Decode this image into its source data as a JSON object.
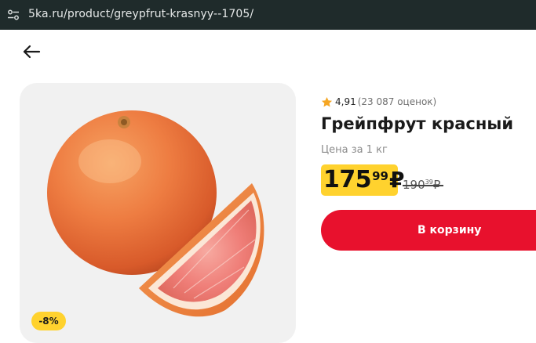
{
  "browser": {
    "url": "5ka.ru/product/greypfrut-krasnyy--1705/"
  },
  "navigation": {
    "back_icon": "arrow-left-icon"
  },
  "product": {
    "rating": "4,91",
    "rating_count": "(23 087 оценок)",
    "title": "Грейпфрут красный",
    "unit_price_label": "Цена за 1 кг",
    "price": {
      "rubles": "175",
      "kopecks": "99",
      "currency": "₽"
    },
    "old_price": {
      "rubles": "190",
      "kopecks": "39",
      "currency": "₽"
    },
    "discount_badge": "-8%",
    "add_to_cart_label": "В корзину",
    "image_subject": "grapefruit"
  },
  "colors": {
    "accent_red": "#e8112d",
    "price_yellow": "#ffd22e",
    "star": "#f5a623",
    "urlbar_bg": "#1f2b2b"
  }
}
